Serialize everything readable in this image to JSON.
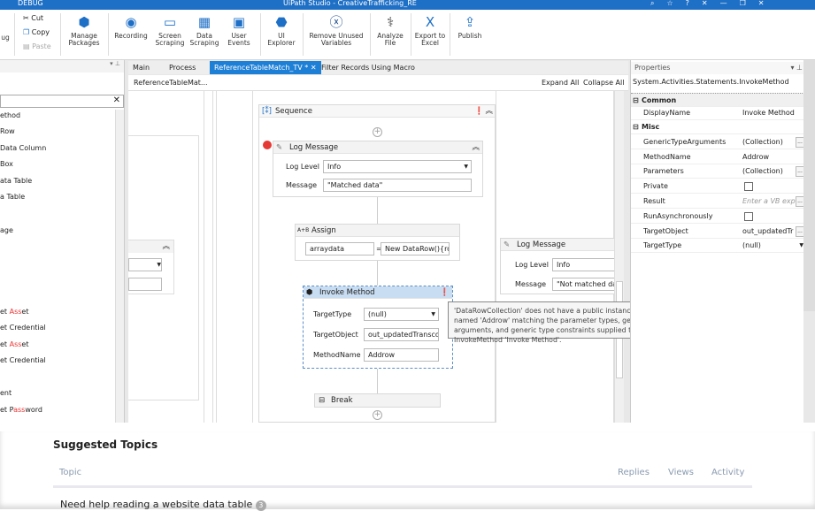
{
  "titlebar": {
    "menu": "DEBUG",
    "title": "UiPath Studio - CreativeTrafficking_RE"
  },
  "ribbon": {
    "debug": "ug",
    "cut": "Cut",
    "copy": "Copy",
    "paste": "Paste",
    "manage_packages": "Manage Packages",
    "recording": "Recording",
    "screen_scraping": "Screen Scraping",
    "data_scraping": "Data Scraping",
    "user_events": "User Events",
    "ui_explorer": "UI Explorer",
    "remove_unused": "Remove Unused Variables",
    "analyze_file": "Analyze File",
    "export_excel": "Export to Excel",
    "publish": "Publish"
  },
  "activities": {
    "items": [
      {
        "label": "ethod"
      },
      {
        "label": " Row"
      },
      {
        "label": "Data Column"
      },
      {
        "label": " Box"
      },
      {
        "label": "ata Table"
      },
      {
        "label": "a Table"
      },
      {
        "label": "age"
      },
      {
        "pre": "et ",
        "hl": "Ass",
        "post": "et"
      },
      {
        "pre": "et Credential",
        "hl": "",
        "post": ""
      },
      {
        "pre": "et ",
        "hl": "Ass",
        "post": "et"
      },
      {
        "pre": "et Credential",
        "hl": "",
        "post": ""
      },
      {
        "label": "ent"
      },
      {
        "pre": "et P",
        "hl": "ass",
        "post": "word"
      }
    ]
  },
  "tabs": [
    {
      "label": "Main"
    },
    {
      "label": "Process"
    },
    {
      "label": "ReferenceTableMatch_TV *"
    },
    {
      "label": "Filter Records Using Macro"
    }
  ],
  "breadcrumb": "ReferenceTableMat...",
  "expand_all": "Expand All",
  "collapse_all": "Collapse All",
  "workflow": {
    "sequence": "Sequence",
    "log1": {
      "title": "Log Message",
      "level_label": "Log Level",
      "level": "Info",
      "message_label": "Message",
      "message": "\"Matched data\""
    },
    "assign": {
      "title": "Assign",
      "to": "arraydata",
      "value": "New DataRow(){ro"
    },
    "invoke": {
      "title": "Invoke Method",
      "target_type_label": "TargetType",
      "target_type": "(null)",
      "target_object_label": "TargetObject",
      "target_object": "out_updatedTransco",
      "method_name_label": "MethodName",
      "method_name": "Addrow"
    },
    "break": "Break",
    "log2": {
      "title": "Log Message",
      "level_label": "Log Level",
      "level": "Info",
      "message_label": "Message",
      "message": "\"Not matched dat"
    }
  },
  "tooltip": "'DataRowCollection' does not have a public instance method named 'Addrow' matching the parameter types, generic type arguments, and generic type constraints supplied to InvokeMethod 'Invoke Method'.",
  "properties": {
    "title": "Properties",
    "type": "System.Activities.Statements.InvokeMethod",
    "common": "Common",
    "misc": "Misc",
    "rows": [
      {
        "k": "DisplayName",
        "v": "Invoke Method"
      },
      {
        "k": "GenericTypeArguments",
        "v": "(Collection)"
      },
      {
        "k": "MethodName",
        "v": "Addrow"
      },
      {
        "k": "Parameters",
        "v": "(Collection)"
      },
      {
        "k": "Private",
        "v": ""
      },
      {
        "k": "Result",
        "v": "Enter a VB exp"
      },
      {
        "k": "RunAsynchronously",
        "v": ""
      },
      {
        "k": "TargetObject",
        "v": "out_updatedTr"
      },
      {
        "k": "TargetType",
        "v": "(null)"
      }
    ]
  },
  "web": {
    "heading": "Suggested Topics",
    "col_topic": "Topic",
    "col_replies": "Replies",
    "col_views": "Views",
    "col_activity": "Activity",
    "topic1": "Need help reading a website data table",
    "topic1_badge": "3"
  },
  "colors": {
    "accent": "#1e6fc6",
    "breakpoint": "#e53935",
    "highlight": "#e33333"
  }
}
